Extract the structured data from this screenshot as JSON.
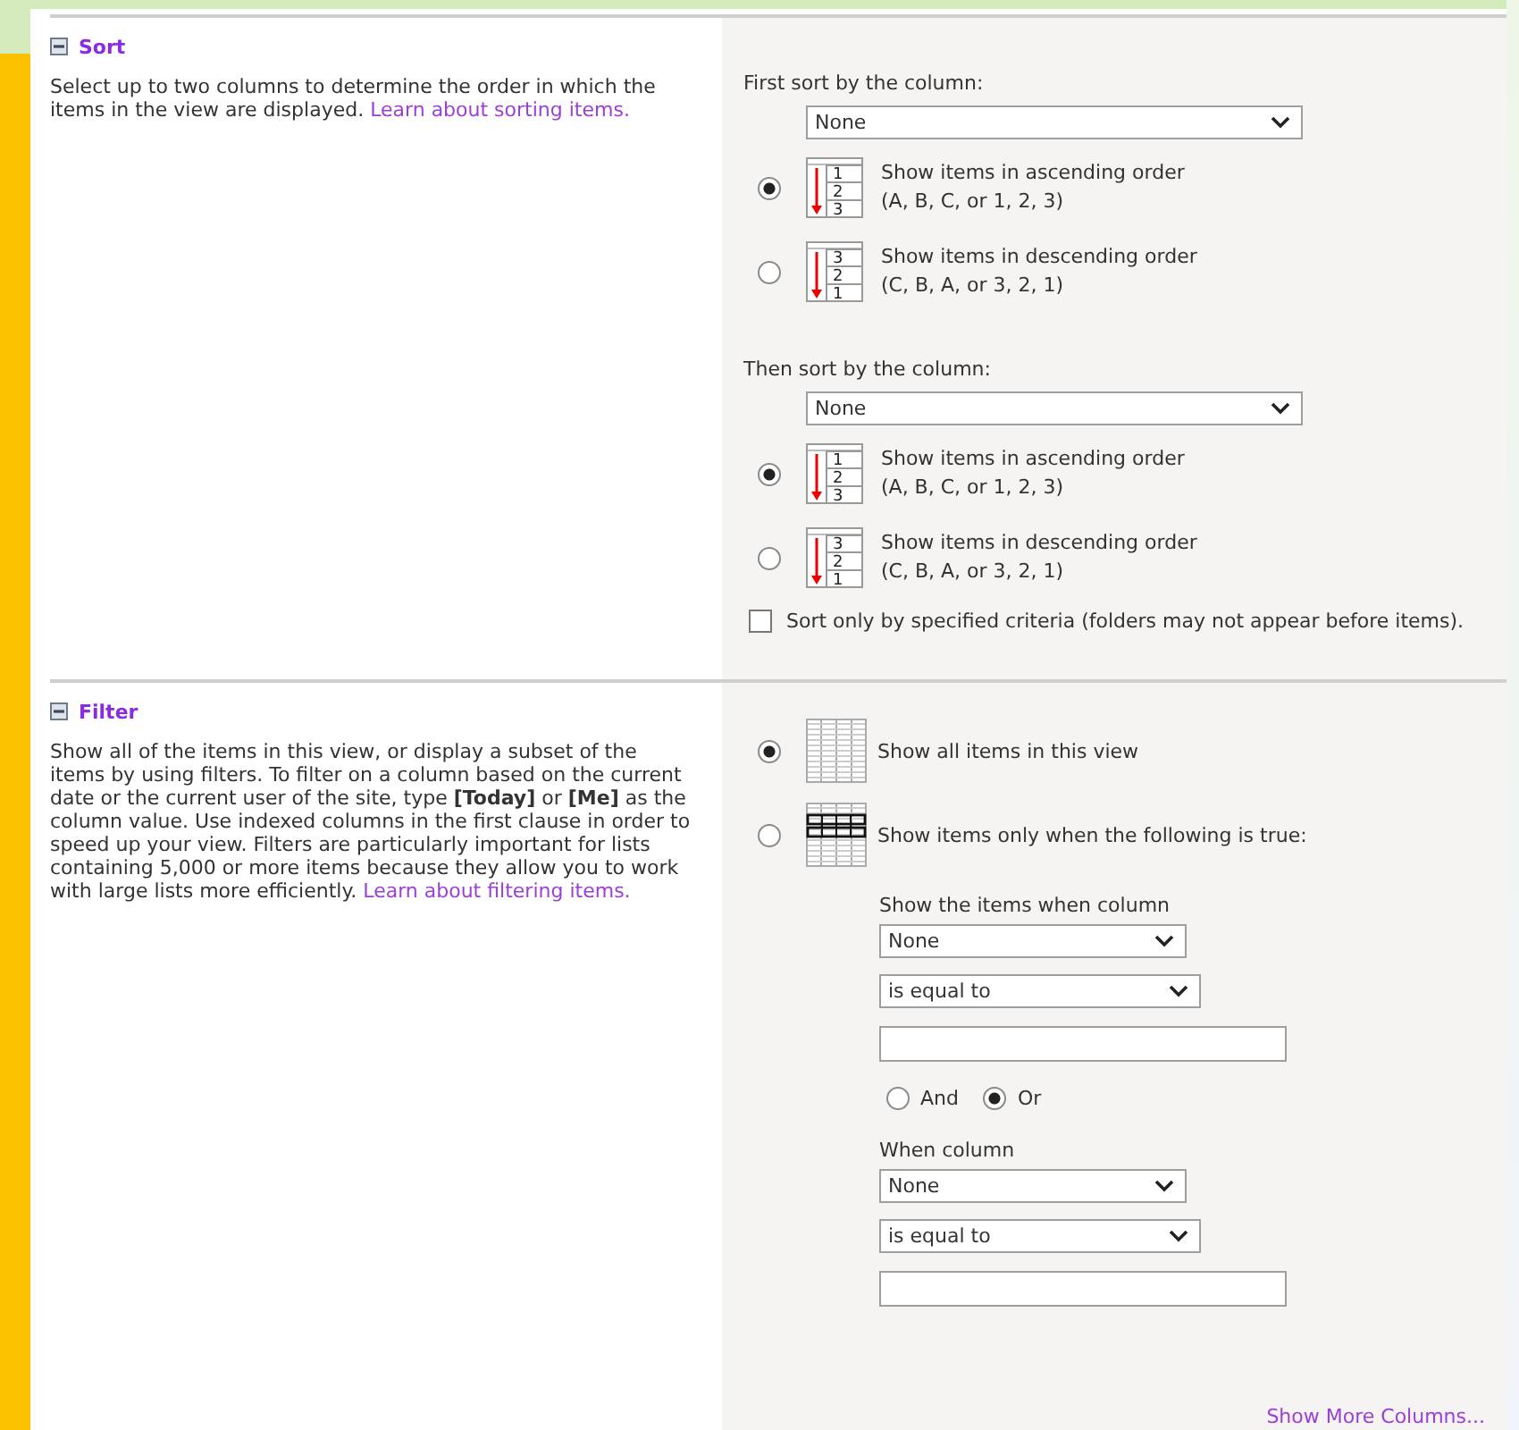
{
  "sort": {
    "title": "Sort",
    "description": "Select up to two columns to determine the order in which the items in the view are displayed.",
    "link": "Learn about sorting items.",
    "groups": [
      {
        "label": "First sort by the column:",
        "value": "None",
        "options": [
          {
            "selected": true,
            "icon_digits": [
              "1",
              "2",
              "3"
            ],
            "title": "Show items in ascending order",
            "example": "(A, B, C, or 1, 2, 3)"
          },
          {
            "selected": false,
            "icon_digits": [
              "3",
              "2",
              "1"
            ],
            "title": "Show items in descending order",
            "example": "(C, B, A, or 3, 2, 1)"
          }
        ]
      },
      {
        "label": "Then sort by the column:",
        "value": "None",
        "options": [
          {
            "selected": true,
            "icon_digits": [
              "1",
              "2",
              "3"
            ],
            "title": "Show items in ascending order",
            "example": "(A, B, C, or 1, 2, 3)"
          },
          {
            "selected": false,
            "icon_digits": [
              "3",
              "2",
              "1"
            ],
            "title": "Show items in descending order",
            "example": "(C, B, A, or 3, 2, 1)"
          }
        ]
      }
    ],
    "criteria": {
      "label": "Sort only by specified criteria (folders may not appear before items).",
      "checked": false
    }
  },
  "filter": {
    "title": "Filter",
    "description": "Show all of the items in this view, or display a subset of the items by using filters. To filter on a column based on the current date or the current user of the site, type **[Today]** or **[Me]** as the column value. Use indexed columns in the first clause in order to speed up your view. Filters are particularly important for lists containing 5,000 or more items because they allow you to work with large lists more efficiently.",
    "link": "Learn about filtering items.",
    "options": [
      {
        "kind": "all",
        "selected": true,
        "label": "Show all items in this view"
      },
      {
        "kind": "conditional",
        "selected": false,
        "label": "Show items only when the following is true:"
      }
    ],
    "clauses": [
      {
        "label": "Show the items when column",
        "column": "None",
        "operator": "is equal to"
      },
      {
        "label": "When column",
        "column": "None",
        "operator": "is equal to"
      }
    ],
    "joiners": [
      {
        "label": "And",
        "selected": false
      },
      {
        "label": "Or",
        "selected": true
      }
    ],
    "more_link": "Show More Columns..."
  }
}
